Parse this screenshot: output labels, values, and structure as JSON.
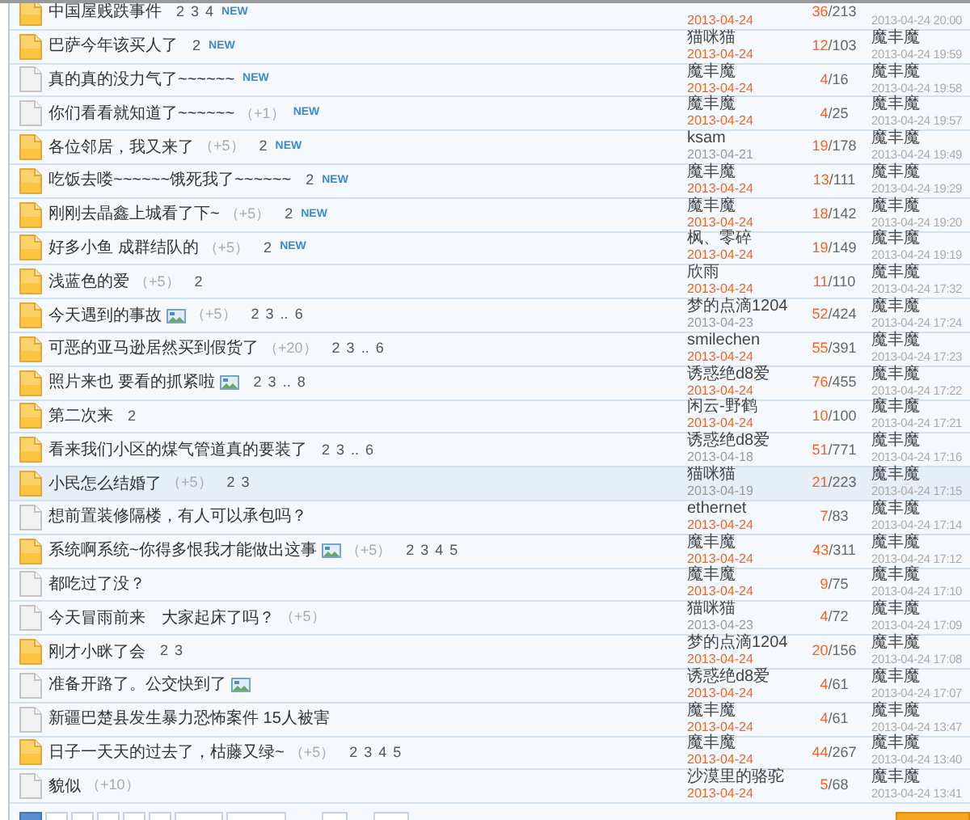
{
  "threads": [
    {
      "kind": "hot",
      "title": "中国屋贱跌事件",
      "pages": [
        "2",
        "3",
        "4"
      ],
      "badge": "NEW",
      "date": "2013-04-24",
      "recent": true,
      "replies": "36",
      "views": "/213",
      "last_time": "2013-04-24 20:00",
      "selected": false
    },
    {
      "kind": "hot",
      "title": "巴萨今年该买人了",
      "pages": [
        "2"
      ],
      "badge": "NEW",
      "author": "猫咪猫",
      "date": "2013-04-24",
      "recent": true,
      "replies": "12",
      "views": "/103",
      "last_poster": "魔丰魔",
      "last_time": "2013-04-24 19:59",
      "selected": false
    },
    {
      "kind": "plain",
      "title": "真的真的没力气了~~~~~~",
      "badge": "NEW",
      "author": "魔丰魔",
      "date": "2013-04-24",
      "recent": true,
      "replies": "4",
      "views": "/16",
      "last_poster": "魔丰魔",
      "last_time": "2013-04-24 19:58",
      "selected": false
    },
    {
      "kind": "plain",
      "title": "你们看看就知道了~~~~~~",
      "bonus": "（+1）",
      "badge": "NEW",
      "author": "魔丰魔",
      "date": "2013-04-24",
      "recent": true,
      "replies": "4",
      "views": "/25",
      "last_poster": "魔丰魔",
      "last_time": "2013-04-24 19:57",
      "selected": false
    },
    {
      "kind": "hot",
      "title": "各位邻居，我又来了",
      "bonus": "（+5）",
      "pages": [
        "2"
      ],
      "badge": "NEW",
      "author": "ksam",
      "date": "2013-04-21",
      "recent": false,
      "replies": "19",
      "views": "/178",
      "last_poster": "魔丰魔",
      "last_time": "2013-04-24 19:49",
      "selected": false
    },
    {
      "kind": "hot",
      "title": "吃饭去喽~~~~~~饿死我了~~~~~~",
      "pages": [
        "2"
      ],
      "badge": "NEW",
      "author": "魔丰魔",
      "date": "2013-04-24",
      "recent": true,
      "replies": "13",
      "views": "/111",
      "last_poster": "魔丰魔",
      "last_time": "2013-04-24 19:29",
      "selected": false
    },
    {
      "kind": "hot",
      "title": "刚刚去晶鑫上城看了下~",
      "bonus": "（+5）",
      "pages": [
        "2"
      ],
      "badge": "NEW",
      "author": "魔丰魔",
      "date": "2013-04-24",
      "recent": true,
      "replies": "18",
      "views": "/142",
      "last_poster": "魔丰魔",
      "last_time": "2013-04-24 19:20",
      "selected": false
    },
    {
      "kind": "hot",
      "title": "好多小鱼 成群结队的",
      "bonus": "（+5）",
      "pages": [
        "2"
      ],
      "badge": "NEW",
      "author": "枫、零碎",
      "date": "2013-04-24",
      "recent": true,
      "replies": "19",
      "views": "/149",
      "last_poster": "魔丰魔",
      "last_time": "2013-04-24 19:19",
      "selected": false
    },
    {
      "kind": "hot",
      "title": "浅蓝色的爱",
      "bonus": "（+5）",
      "pages": [
        "2"
      ],
      "author": "欣雨",
      "date": "2013-04-24",
      "recent": true,
      "replies": "11",
      "views": "/110",
      "last_poster": "魔丰魔",
      "last_time": "2013-04-24 17:32",
      "selected": false
    },
    {
      "kind": "hot",
      "title": "今天遇到的事故",
      "bonus": "（+5）",
      "has_image": true,
      "pages": [
        "2",
        "3",
        "..",
        "6"
      ],
      "author": "梦的点滴1204",
      "date": "2013-04-23",
      "recent": false,
      "replies": "52",
      "views": "/424",
      "last_poster": "魔丰魔",
      "last_time": "2013-04-24 17:24",
      "selected": false
    },
    {
      "kind": "hot",
      "title": "可恶的亚马逊居然买到假货了",
      "bonus": "（+20）",
      "pages": [
        "2",
        "3",
        "..",
        "6"
      ],
      "author": "smilechen",
      "date": "2013-04-24",
      "recent": true,
      "replies": "55",
      "views": "/391",
      "last_poster": "魔丰魔",
      "last_time": "2013-04-24 17:23",
      "selected": false
    },
    {
      "kind": "hot",
      "title": "照片来也 要看的抓紧啦",
      "has_image": true,
      "pages": [
        "2",
        "3",
        "..",
        "8"
      ],
      "author": "诱惑绝d8爱",
      "date": "2013-04-24",
      "recent": true,
      "replies": "76",
      "views": "/455",
      "last_poster": "魔丰魔",
      "last_time": "2013-04-24 17:22",
      "selected": false
    },
    {
      "kind": "hot",
      "title": "第二次来",
      "pages": [
        "2"
      ],
      "author": "闲云-野鹤",
      "date": "2013-04-24",
      "recent": true,
      "replies": "10",
      "views": "/100",
      "last_poster": "魔丰魔",
      "last_time": "2013-04-24 17:21",
      "selected": false
    },
    {
      "kind": "hot",
      "title": "看来我们小区的煤气管道真的要装了",
      "pages": [
        "2",
        "3",
        "..",
        "6"
      ],
      "author": "诱惑绝d8爱",
      "date": "2013-04-18",
      "recent": false,
      "replies": "51",
      "views": "/771",
      "last_poster": "魔丰魔",
      "last_time": "2013-04-24 17:16",
      "selected": false
    },
    {
      "kind": "hot",
      "title": "小民怎么结婚了",
      "bonus": "（+5）",
      "pages": [
        "2",
        "3"
      ],
      "author": "猫咪猫",
      "date": "2013-04-19",
      "recent": false,
      "replies": "21",
      "views": "/223",
      "last_poster": "魔丰魔",
      "last_time": "2013-04-24 17:15",
      "selected": true
    },
    {
      "kind": "plain",
      "title": "想前置装修隔楼，有人可以承包吗？",
      "author": "ethernet",
      "date": "2013-04-24",
      "recent": true,
      "replies": "7",
      "views": "/83",
      "last_poster": "魔丰魔",
      "last_time": "2013-04-24 17:14",
      "selected": false
    },
    {
      "kind": "hot",
      "title": "系统啊系统~你得多恨我才能做出这事",
      "bonus": "（+5）",
      "has_image": true,
      "pages": [
        "2",
        "3",
        "4",
        "5"
      ],
      "author": "魔丰魔",
      "date": "2013-04-24",
      "recent": true,
      "replies": "43",
      "views": "/311",
      "last_poster": "魔丰魔",
      "last_time": "2013-04-24 17:12",
      "selected": false
    },
    {
      "kind": "plain",
      "title": "都吃过了没？",
      "author": "魔丰魔",
      "date": "2013-04-24",
      "recent": true,
      "replies": "9",
      "views": "/75",
      "last_poster": "魔丰魔",
      "last_time": "2013-04-24 17:10",
      "selected": false
    },
    {
      "kind": "plain",
      "title": "今天冒雨前来　大家起床了吗？",
      "bonus": "（+5）",
      "author": "猫咪猫",
      "date": "2013-04-23",
      "recent": false,
      "replies": "4",
      "views": "/72",
      "last_poster": "魔丰魔",
      "last_time": "2013-04-24 17:09",
      "selected": false
    },
    {
      "kind": "hot",
      "title": "刚才小眯了会",
      "pages": [
        "2",
        "3"
      ],
      "author": "梦的点滴1204",
      "date": "2013-04-24",
      "recent": true,
      "replies": "20",
      "views": "/156",
      "last_poster": "魔丰魔",
      "last_time": "2013-04-24 17:08",
      "selected": false
    },
    {
      "kind": "plain",
      "title": "准备开路了。公交快到了",
      "has_image": true,
      "author": "诱惑绝d8爱",
      "date": "2013-04-24",
      "recent": true,
      "replies": "4",
      "views": "/61",
      "last_poster": "魔丰魔",
      "last_time": "2013-04-24 17:07",
      "selected": false
    },
    {
      "kind": "plain",
      "title": "新疆巴楚县发生暴力恐怖案件 15人被害",
      "author": "魔丰魔",
      "date": "2013-04-24",
      "recent": true,
      "replies": "4",
      "views": "/61",
      "last_poster": "魔丰魔",
      "last_time": "2013-04-24 13:47",
      "selected": false
    },
    {
      "kind": "hot",
      "title": "日子一天天的过去了，枯藤又绿~",
      "bonus": "（+5）",
      "pages": [
        "2",
        "3",
        "4",
        "5"
      ],
      "author": "魔丰魔",
      "date": "2013-04-24",
      "recent": true,
      "replies": "44",
      "views": "/267",
      "last_poster": "魔丰魔",
      "last_time": "2013-04-24 13:40",
      "selected": false
    },
    {
      "kind": "plain",
      "title": "貌似",
      "bonus": "（+10）",
      "author": "沙漠里的骆驼",
      "date": "2013-04-24",
      "recent": true,
      "replies": "5",
      "views": "/68",
      "last_poster": "魔丰魔",
      "last_time": "2013-04-24 13:41",
      "selected": false
    }
  ]
}
